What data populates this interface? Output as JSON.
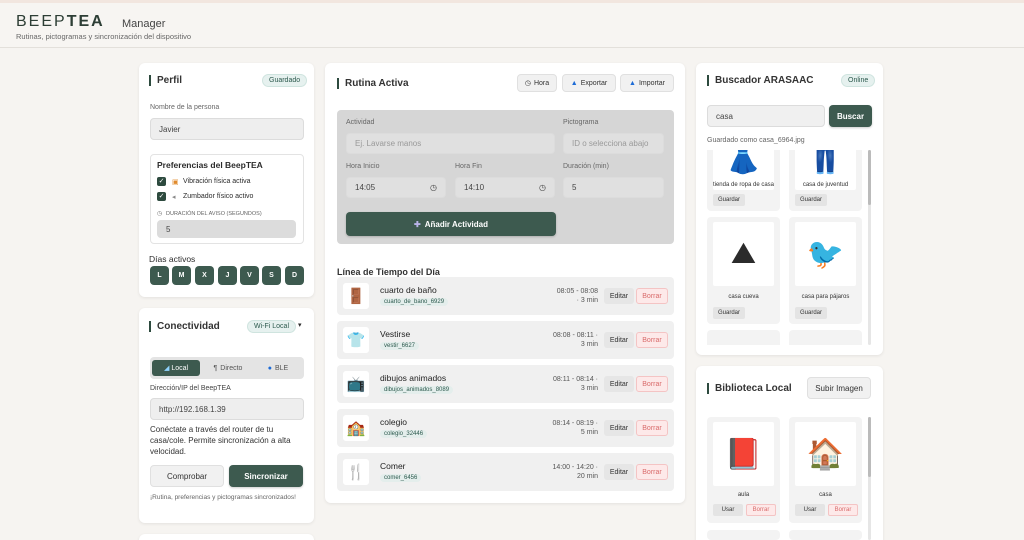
{
  "header": {
    "brand_light": "BEEP",
    "brand_bold": "TEA",
    "subtitle": "Manager",
    "tagline": "Rutinas, pictogramas y sincronización del dispositivo"
  },
  "perfil": {
    "title": "Perfil",
    "badge": "Guardado",
    "name_label": "Nombre de la persona",
    "name_value": "Javier",
    "prefs_title": "Preferencias del BeepTEA",
    "vibration_label": "Vibración física activa",
    "buzzer_label": "Zumbador físico activo",
    "duration_label": "DURACIÓN DEL AVISO (SEGUNDOS)",
    "duration_value": "5",
    "days_label": "Días activos",
    "days": [
      "L",
      "M",
      "X",
      "J",
      "V",
      "S",
      "D"
    ]
  },
  "conectividad": {
    "title": "Conectividad",
    "badge": "Wi-Fi Local",
    "modes": [
      "Local",
      "Directo",
      "BLE"
    ],
    "ip_label": "Dirección/IP del BeepTEA",
    "ip_value": "http://192.168.1.39",
    "help": "Conéctate a través del router de tu casa/cole. Permite sincronización a alta velocidad.",
    "check_button": "Comprobar",
    "sync_button": "Sincronizar",
    "status": "¡Rutina, preferencias y pictogramas sincronizados!"
  },
  "rutina": {
    "title": "Rutina Activa",
    "hora_button": "Hora",
    "export_button": "Exportar",
    "import_button": "Importar",
    "activity_label": "Actividad",
    "activity_placeholder": "Ej. Lavarse manos",
    "picto_label": "Pictograma",
    "picto_placeholder": "ID o selecciona abajo",
    "start_label": "Hora Inicio",
    "start_value": "14:05",
    "end_label": "Hora Fin",
    "end_value": "14:10",
    "duration_label": "Duración (min)",
    "duration_value": "5",
    "add_button": "Añadir Actividad",
    "timeline_title": "Línea de Tiempo del Día",
    "edit_label": "Editar",
    "delete_label": "Borrar",
    "items": [
      {
        "title": "cuarto de baño",
        "tag": "cuarto_de_bano_6929",
        "time": "08:05 - 08:08",
        "dur": "· 3 min",
        "icon": "🚪"
      },
      {
        "title": "Vestirse",
        "tag": "vestir_6627",
        "time": "08:08 - 08:11 ·",
        "dur": "3 min",
        "icon": "👕"
      },
      {
        "title": "dibujos animados",
        "tag": "dibujos_animados_8089",
        "time": "08:11 - 08:14 ·",
        "dur": "3 min",
        "icon": "📺"
      },
      {
        "title": "colegio",
        "tag": "colegio_32446",
        "time": "08:14 - 08:19 ·",
        "dur": "5 min",
        "icon": "🏫"
      },
      {
        "title": "Comer",
        "tag": "comer_6456",
        "time": "14:00 - 14:20 ·",
        "dur": "20 min",
        "icon": "🍴"
      }
    ]
  },
  "buscador": {
    "title": "Buscador ARASAAC",
    "badge": "Online",
    "search_value": "casa",
    "search_button": "Buscar",
    "saved_note": "Guardado como casa_6964.jpg",
    "save_label": "Guardar",
    "results": [
      {
        "name": "tienda de ropa de casa",
        "icon": "👗"
      },
      {
        "name": "casa de juventud",
        "icon": "👖"
      },
      {
        "name": "casa cueva",
        "icon": "⛰"
      },
      {
        "name": "casa para pájaros",
        "icon": "🐦"
      }
    ]
  },
  "biblioteca": {
    "title": "Biblioteca Local",
    "upload_button": "Subir Imagen",
    "use_label": "Usar",
    "delete_label": "Borrar",
    "items": [
      {
        "name": "aula",
        "icon": "📕"
      },
      {
        "name": "casa",
        "icon": "🏠"
      }
    ]
  }
}
